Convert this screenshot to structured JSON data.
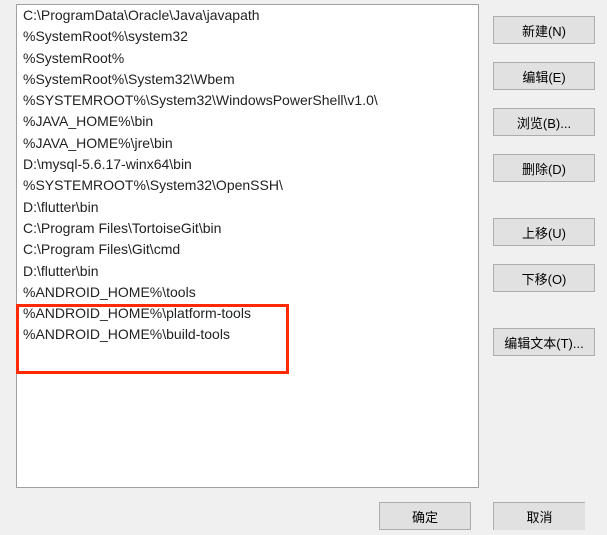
{
  "paths": [
    "C:\\ProgramData\\Oracle\\Java\\javapath",
    "%SystemRoot%\\system32",
    "%SystemRoot%",
    "%SystemRoot%\\System32\\Wbem",
    "%SYSTEMROOT%\\System32\\WindowsPowerShell\\v1.0\\",
    "%JAVA_HOME%\\bin",
    "%JAVA_HOME%\\jre\\bin",
    "D:\\mysql-5.6.17-winx64\\bin",
    "%SYSTEMROOT%\\System32\\OpenSSH\\",
    "D:\\flutter\\bin",
    "C:\\Program Files\\TortoiseGit\\bin",
    "C:\\Program Files\\Git\\cmd",
    "D:\\flutter\\bin",
    "%ANDROID_HOME%\\tools",
    "%ANDROID_HOME%\\platform-tools",
    "%ANDROID_HOME%\\build-tools"
  ],
  "buttons": {
    "new": "新建(N)",
    "edit": "编辑(E)",
    "browse": "浏览(B)...",
    "delete": "删除(D)",
    "moveup": "上移(U)",
    "movedown": "下移(O)",
    "edittext": "编辑文本(T)..."
  },
  "footer": {
    "ok": "确定",
    "cancel": "取消"
  },
  "highlight": {
    "start_index": 13,
    "count": 3
  }
}
